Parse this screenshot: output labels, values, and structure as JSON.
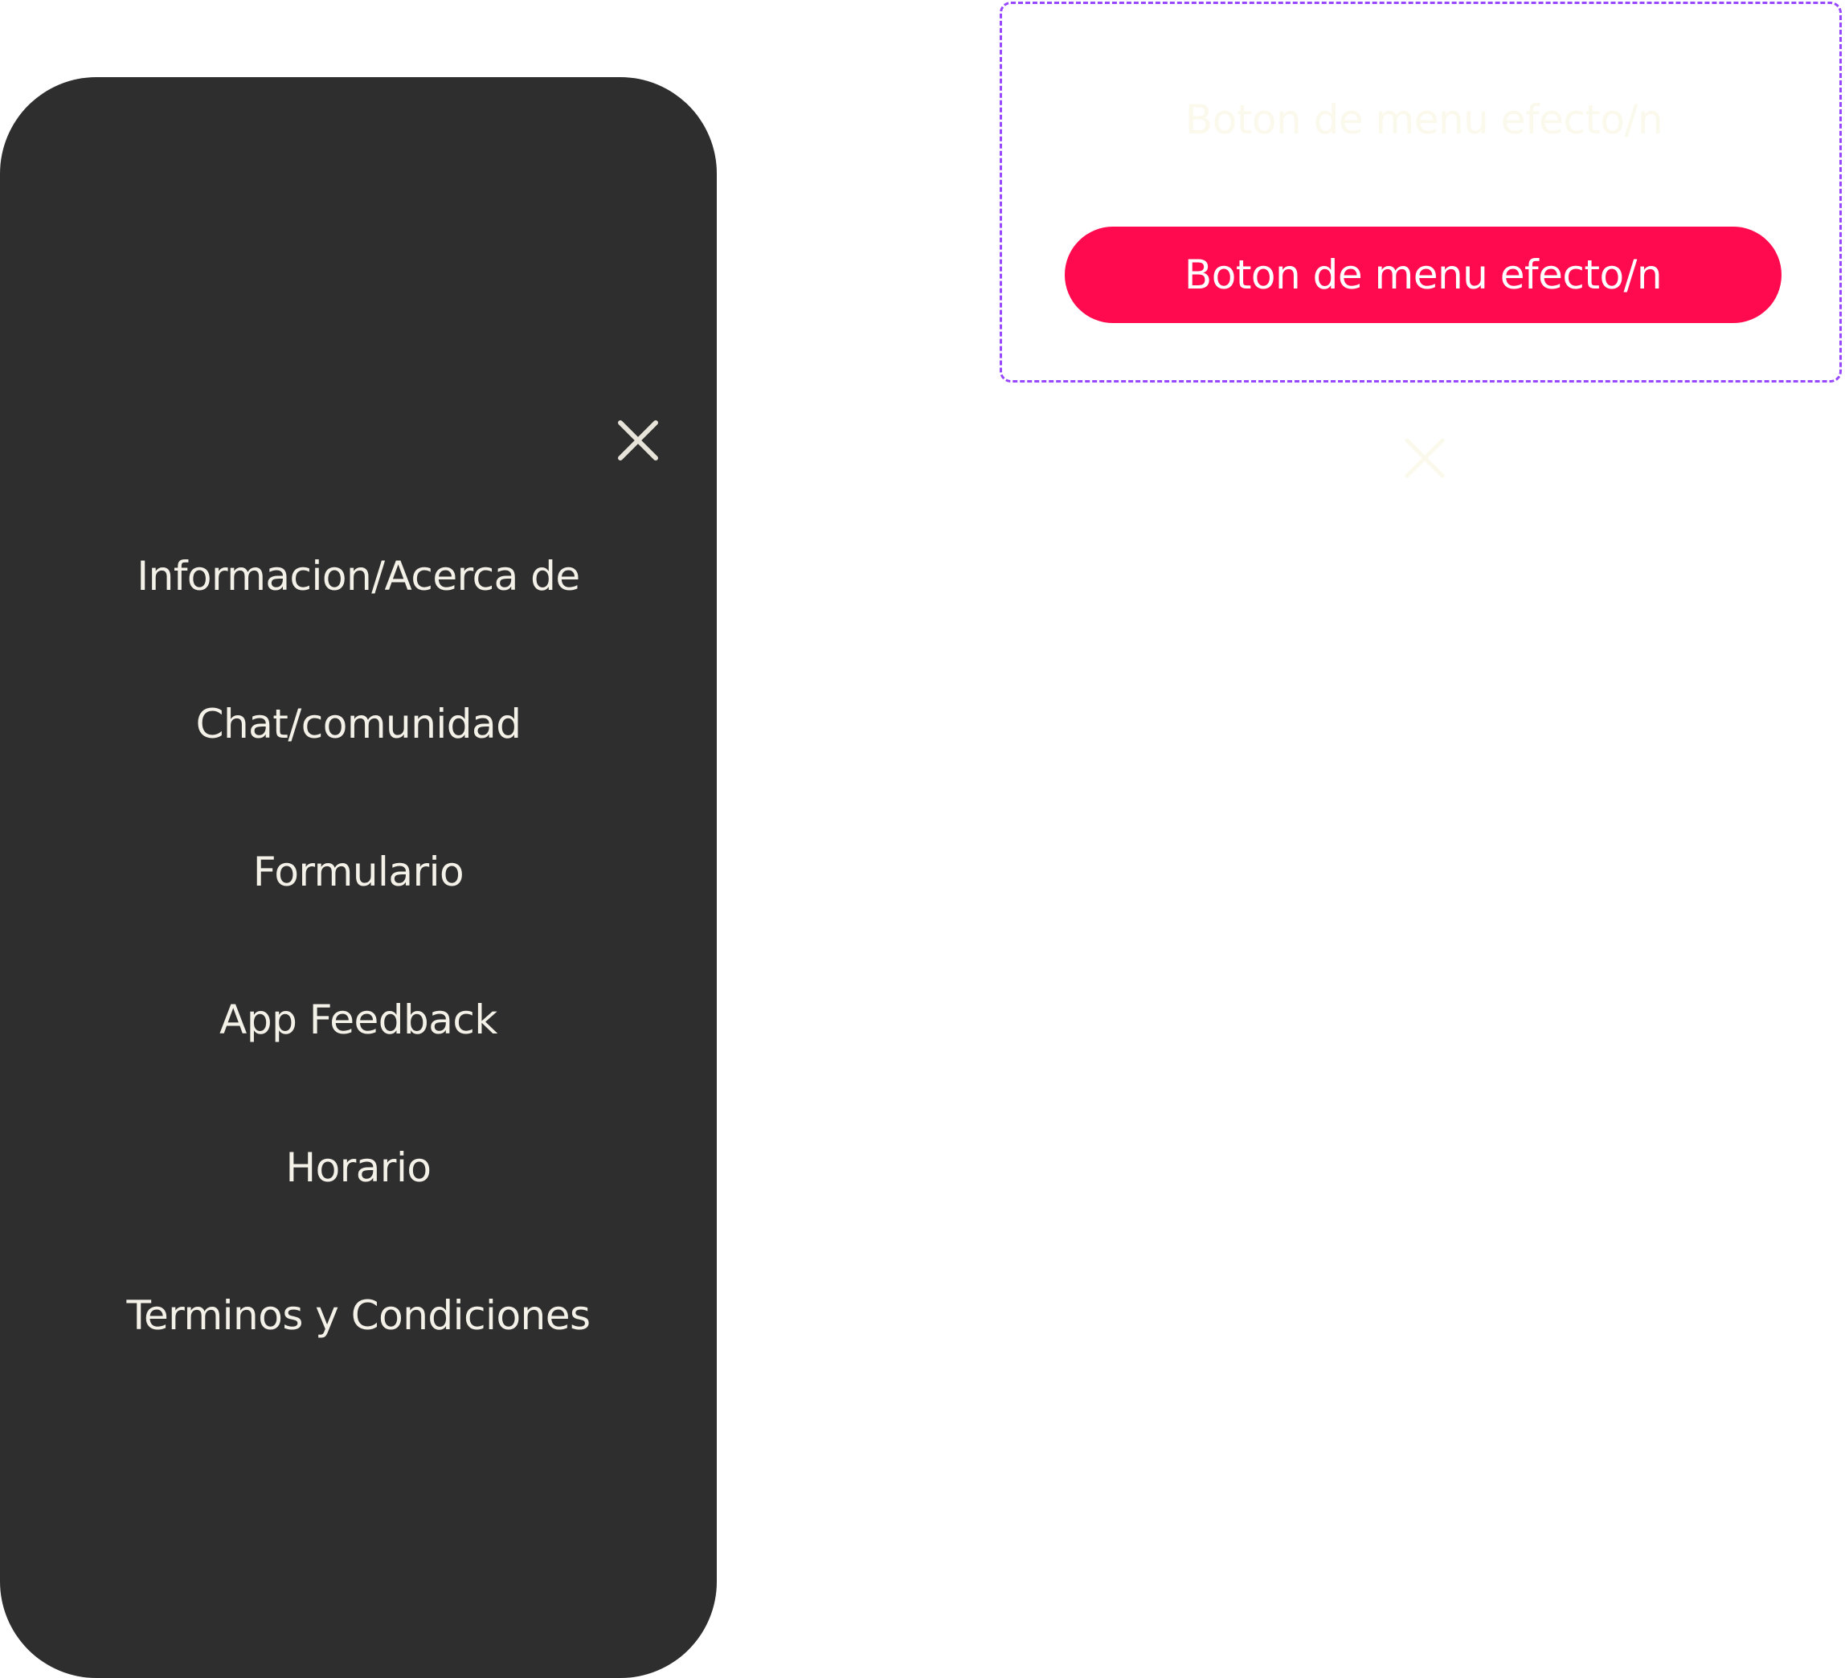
{
  "menu": {
    "close_icon": "close-icon",
    "items": [
      {
        "label": "Informacion/Acerca de"
      },
      {
        "label": "Chat/comunidad"
      },
      {
        "label": "Formulario"
      },
      {
        "label": "App Feedback"
      },
      {
        "label": "Horario"
      },
      {
        "label": "Terminos y Condiciones"
      }
    ],
    "colors": {
      "panel": "#2e2e2e",
      "text": "#f4f1e8"
    }
  },
  "component": {
    "variants": [
      {
        "label": "Boton de menu efecto/n",
        "state": "default"
      },
      {
        "label": "Boton de menu efecto/n",
        "state": "pressed"
      }
    ],
    "colors": {
      "frame_border": "#9747ff",
      "pressed_fill": "#ff0a4e",
      "pressed_text": "#ffffff",
      "default_text": "#fbf8ec"
    }
  },
  "standalone_icon": "close-icon"
}
